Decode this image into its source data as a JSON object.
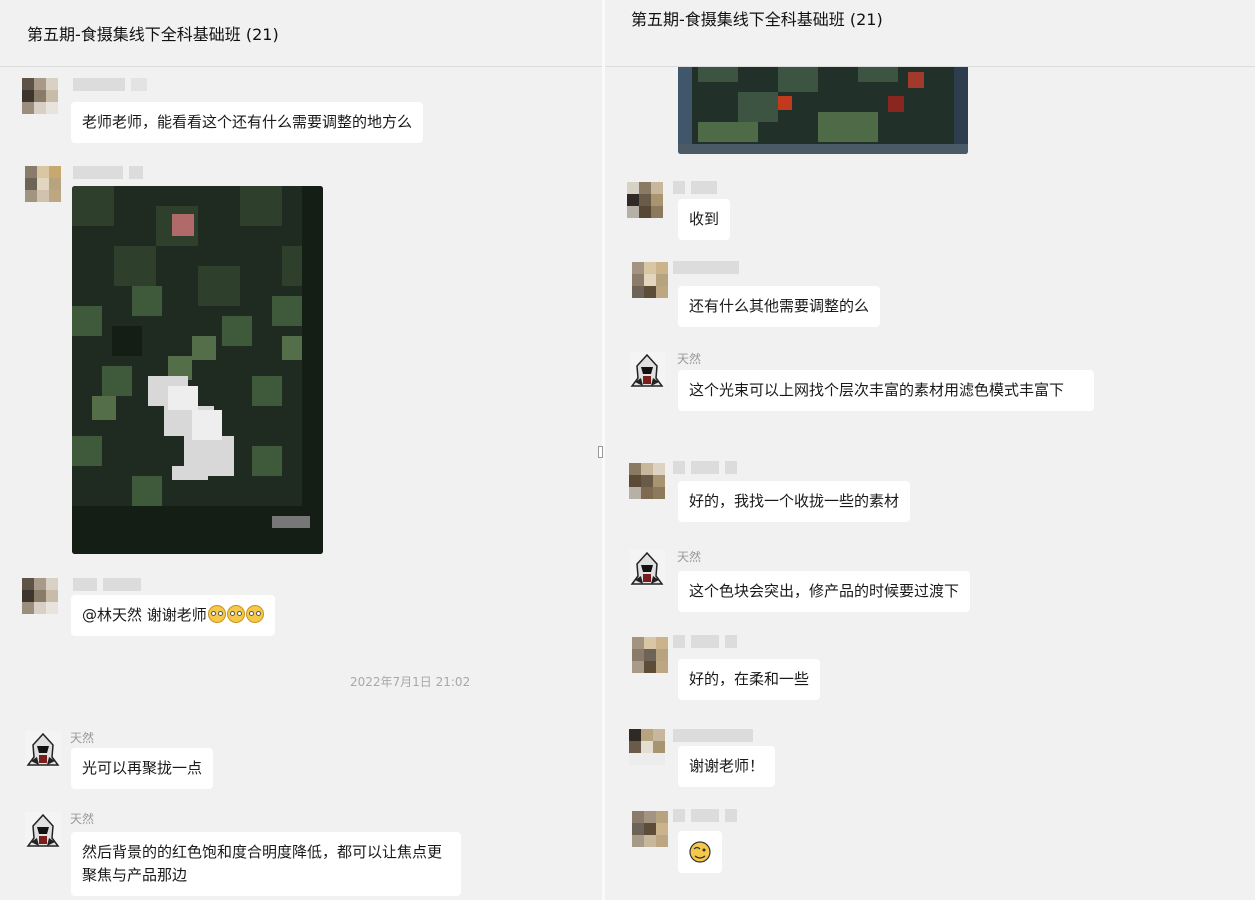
{
  "left": {
    "title": "第五期-食摄集线下全科基础班 (21)",
    "messages": [
      {
        "text": "老师老师，能看看这个还有什么需要调整的地方么"
      },
      {
        "text": "@林天然 谢谢老师"
      },
      {
        "sender": "天然",
        "text": "光可以再聚拢一点"
      },
      {
        "sender": "天然",
        "text": "然后背景的的红色饱和度合明度降低，都可以让焦点更聚焦与产品那边"
      }
    ],
    "timestamp": "2022年7月1日 21:02"
  },
  "right": {
    "title": "第五期-食摄集线下全科基础班 (21)",
    "messages": [
      {
        "text": "收到"
      },
      {
        "text": "还有什么其他需要调整的么"
      },
      {
        "sender": "天然",
        "text": "这个光束可以上网找个层次丰富的素材用滤色模式丰富下"
      },
      {
        "text": "好的，我找一个收拢一些的素材"
      },
      {
        "sender": "天然",
        "text": "这个色块会突出，修产品的时候要过渡下"
      },
      {
        "text": "好的，在柔和一些"
      },
      {
        "text": "谢谢老师！"
      }
    ]
  },
  "icons": {
    "avatar_teacher": "hooded-assassin-avatar-icon",
    "emoji": "dizzy-face-emoji-icon",
    "sticker": "winking-face-sticker-icon"
  },
  "colors": {
    "background": "#f1f1f1",
    "bubble": "#ffffff",
    "timestamp": "#a8a8a8"
  }
}
